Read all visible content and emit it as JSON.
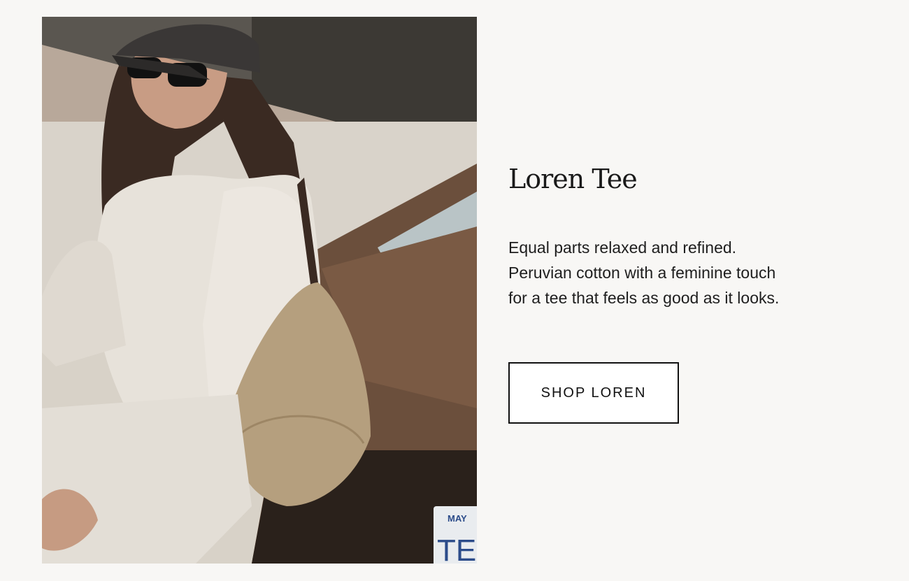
{
  "product": {
    "title": "Loren Tee",
    "description_lines": [
      "Equal parts relaxed and refined.",
      "Peruvian cotton with a feminine touch",
      "for a tee that feels as good as it looks."
    ],
    "cta_label": "SHOP LOREN"
  },
  "photo": {
    "plate_text": "MAY",
    "plate_letters": "TE"
  },
  "colors": {
    "background": "#f8f7f5",
    "text": "#1a1a1a",
    "button_border": "#111111"
  }
}
